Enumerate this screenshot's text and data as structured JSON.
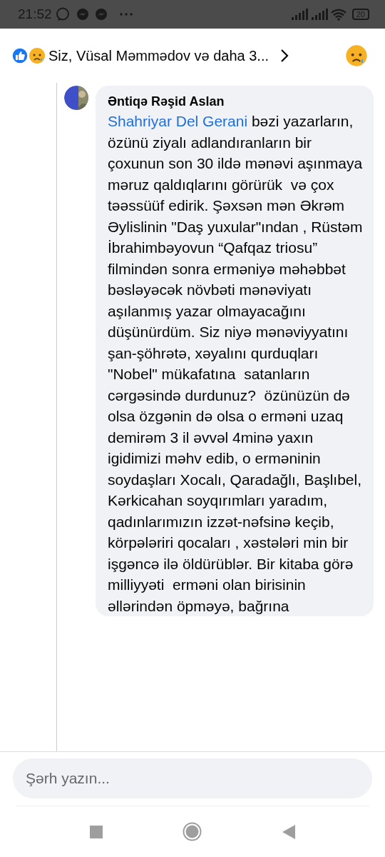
{
  "status_bar": {
    "time": "21:52",
    "battery": "20"
  },
  "reactions_bar": {
    "summary": "Siz, Vüsal Məmmədov və daha 3..."
  },
  "comment": {
    "author": "Əntiqə Rəşid Aslan",
    "mention": "Shahriyar Del Gerani",
    "text": " bəzi yazarların, özünü ziyalı adlandıranların bir çoxunun son 30 ildə mənəvi aşınmaya məruz qaldıqlarını görürük  və çox təəssüüf edirik. Şəxsən mən Əkrəm Əylislinin \"Daş yuxular\"ından , Rüstəm İbrahimbəyovun “Qafqaz triosu” filmindən sonra erməniyə məhəbbət bəsləyəcək növbəti mənəviyatı aşılanmış yazar olmayacağını düşünürdüm. Siz niyə mənəviyyatını şan-şöhrətə, xəyalını qurduqları \"Nobel\" mükafatına  satanların cərgəsində durdunuz?  özünüzün də olsa özgənin də olsa o erməni uzaq demirəm 3 il əvvəl 4minə yaxın igidimizi məhv edib, o erməninin soydaşları Xocalı, Qaradağlı, Başlıbel, Kərkicahan soyqırımları yaradım, qadınlarımızın izzət-nəfsinə keçib, körpələriri qocaları , xəstələri min bir işgəncə ilə öldürüblər. Bir kitaba görə milliyyəti  erməni olan birisinin əllərindən öpməyə, bağrına"
  },
  "composer": {
    "placeholder": "Şərh yazın..."
  }
}
